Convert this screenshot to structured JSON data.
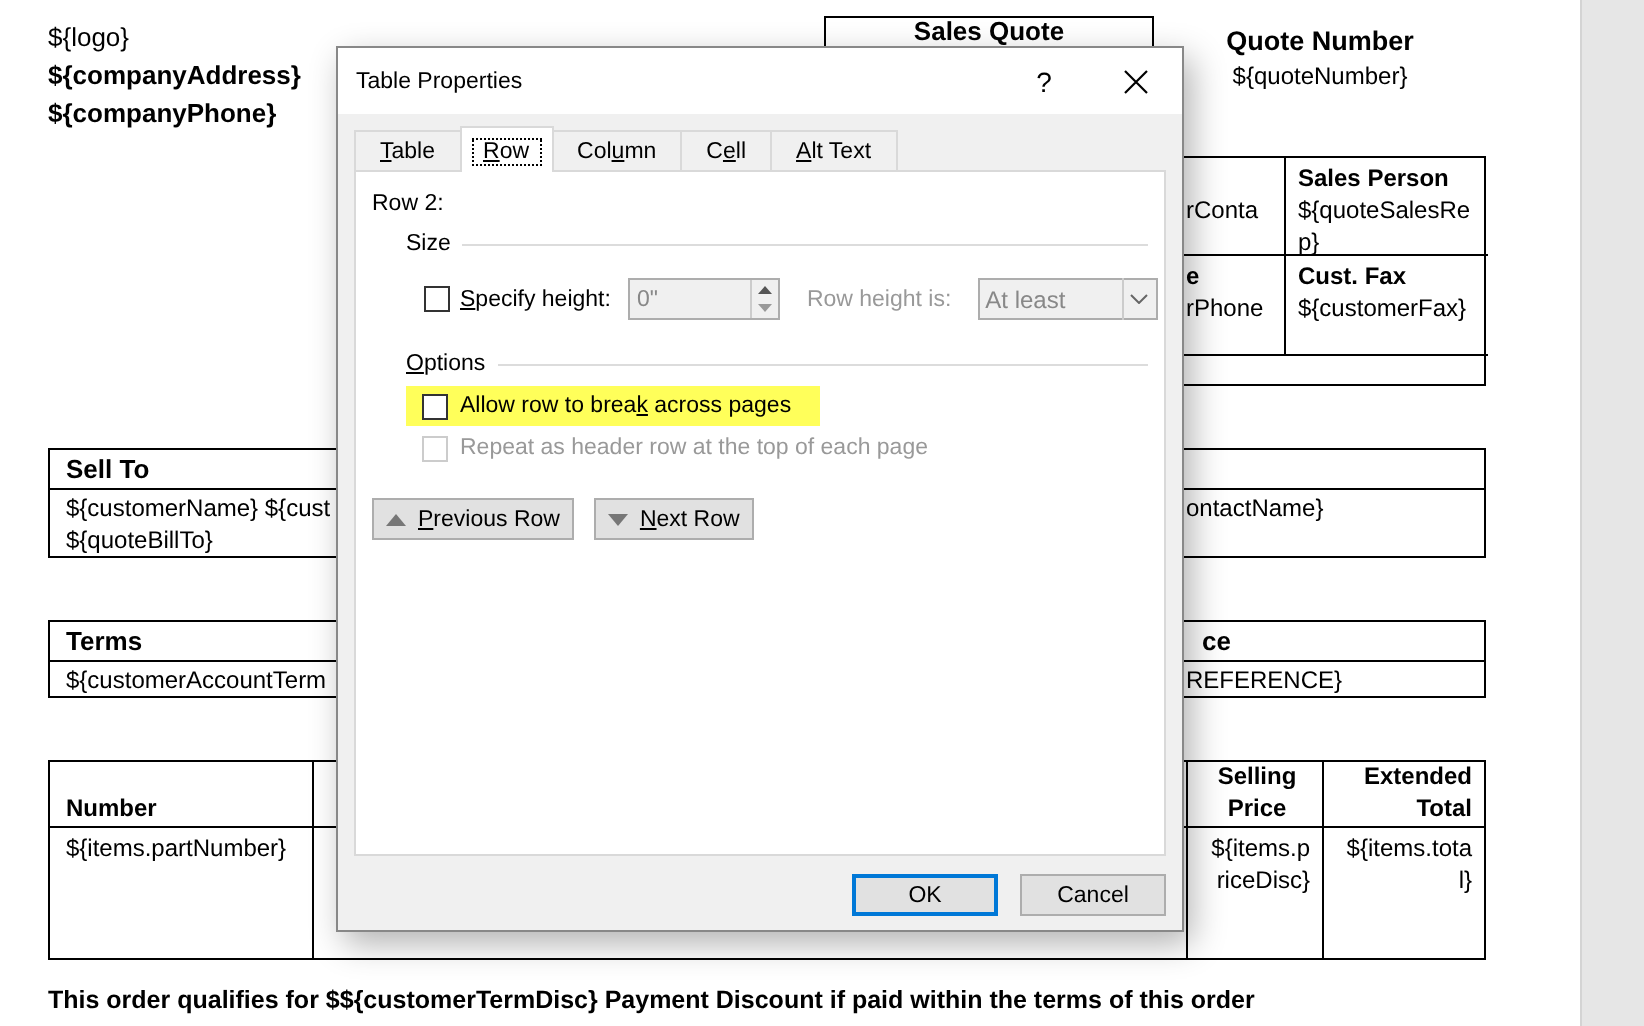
{
  "document": {
    "header_lines": [
      {
        "text": "${logo}",
        "bold": false
      },
      {
        "text": "${companyAddress}",
        "bold": true
      },
      {
        "text": "${companyPhone}",
        "bold": true
      }
    ],
    "title": "Sales Quote",
    "quote_number": {
      "label": "Quote Number",
      "value": "${quoteNumber}"
    },
    "info_table": {
      "rows": [
        {
          "column_1": [
            {
              "text": "rConta",
              "bold": false
            }
          ],
          "column_2": [
            {
              "text": "Sales Person",
              "bold": true
            },
            {
              "text": "${quoteSalesRep}",
              "bold": false
            }
          ]
        },
        {
          "column_1": [
            {
              "text": "e",
              "bold": true
            },
            {
              "text": "rPhone",
              "bold": false
            }
          ],
          "column_2": [
            {
              "text": "Cust. Fax",
              "bold": true
            },
            {
              "text": "${customerFax}",
              "bold": false
            }
          ]
        }
      ]
    },
    "sections": [
      {
        "heading": "Sell To",
        "lines": [
          "${customerName} ${cust",
          "${quoteBillTo}"
        ],
        "right_line": "ontactName}"
      },
      {
        "heading": "Terms",
        "heading_right": "ce",
        "lines": [
          "${customerAccountTerm"
        ],
        "right_line": "REFERENCE}"
      }
    ],
    "items_table": {
      "columns": [
        {
          "label": "Number"
        },
        {
          "label": "Selling Price"
        },
        {
          "label": "Extended Total"
        }
      ],
      "row": [
        [
          "${items.partNumber}"
        ],
        [
          "${items.priceDisc}"
        ],
        [
          "${items.total}"
        ]
      ]
    },
    "footer_note": "This order qualifies for $${customerTermDisc} Payment Discount if paid within the terms of this order"
  },
  "dialog": {
    "title": "Table Properties",
    "help": "?",
    "tabs": [
      {
        "key": "T",
        "post": "able",
        "selected": false
      },
      {
        "key": "R",
        "post": "ow",
        "selected": true
      },
      {
        "pre": "Col",
        "key": "u",
        "post": "mn",
        "selected": false
      },
      {
        "pre": "C",
        "key": "e",
        "post": "ll",
        "selected": false
      },
      {
        "key": "A",
        "post": "lt Text",
        "selected": false
      }
    ],
    "row_label": "Row 2:",
    "size_group": {
      "title": "Size",
      "specify_height": {
        "key": "S",
        "post": "pecify height:",
        "checked": false
      },
      "height_value": "0\"",
      "height_disabled": true,
      "row_height_label": "Row height is:",
      "row_height_value": "At least"
    },
    "options_group": {
      "title": {
        "key": "O",
        "post": "ptions"
      },
      "checkboxes": [
        {
          "pre": "Allow row to brea",
          "key": "k",
          "post": " across pages",
          "checked": false,
          "disabled": false,
          "highlighted": true
        },
        {
          "label": "Repeat as header row at the top of each page",
          "checked": false,
          "disabled": true,
          "highlighted": false
        }
      ]
    },
    "nav_buttons": [
      {
        "kind": "previous",
        "key": "P",
        "post": "revious Row"
      },
      {
        "kind": "next",
        "key": "N",
        "post": "ext Row"
      }
    ],
    "buttons": [
      {
        "label": "OK",
        "default": true
      },
      {
        "label": "Cancel",
        "default": false
      }
    ]
  }
}
